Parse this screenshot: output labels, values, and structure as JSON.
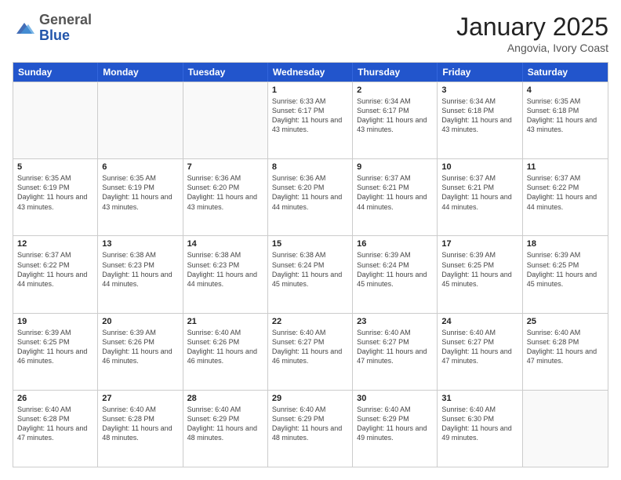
{
  "header": {
    "logo": {
      "general": "General",
      "blue": "Blue"
    },
    "title": "January 2025",
    "subtitle": "Angovia, Ivory Coast"
  },
  "days_of_week": [
    "Sunday",
    "Monday",
    "Tuesday",
    "Wednesday",
    "Thursday",
    "Friday",
    "Saturday"
  ],
  "weeks": [
    [
      {
        "day": "",
        "info": ""
      },
      {
        "day": "",
        "info": ""
      },
      {
        "day": "",
        "info": ""
      },
      {
        "day": "1",
        "info": "Sunrise: 6:33 AM\nSunset: 6:17 PM\nDaylight: 11 hours and 43 minutes."
      },
      {
        "day": "2",
        "info": "Sunrise: 6:34 AM\nSunset: 6:17 PM\nDaylight: 11 hours and 43 minutes."
      },
      {
        "day": "3",
        "info": "Sunrise: 6:34 AM\nSunset: 6:18 PM\nDaylight: 11 hours and 43 minutes."
      },
      {
        "day": "4",
        "info": "Sunrise: 6:35 AM\nSunset: 6:18 PM\nDaylight: 11 hours and 43 minutes."
      }
    ],
    [
      {
        "day": "5",
        "info": "Sunrise: 6:35 AM\nSunset: 6:19 PM\nDaylight: 11 hours and 43 minutes."
      },
      {
        "day": "6",
        "info": "Sunrise: 6:35 AM\nSunset: 6:19 PM\nDaylight: 11 hours and 43 minutes."
      },
      {
        "day": "7",
        "info": "Sunrise: 6:36 AM\nSunset: 6:20 PM\nDaylight: 11 hours and 43 minutes."
      },
      {
        "day": "8",
        "info": "Sunrise: 6:36 AM\nSunset: 6:20 PM\nDaylight: 11 hours and 44 minutes."
      },
      {
        "day": "9",
        "info": "Sunrise: 6:37 AM\nSunset: 6:21 PM\nDaylight: 11 hours and 44 minutes."
      },
      {
        "day": "10",
        "info": "Sunrise: 6:37 AM\nSunset: 6:21 PM\nDaylight: 11 hours and 44 minutes."
      },
      {
        "day": "11",
        "info": "Sunrise: 6:37 AM\nSunset: 6:22 PM\nDaylight: 11 hours and 44 minutes."
      }
    ],
    [
      {
        "day": "12",
        "info": "Sunrise: 6:37 AM\nSunset: 6:22 PM\nDaylight: 11 hours and 44 minutes."
      },
      {
        "day": "13",
        "info": "Sunrise: 6:38 AM\nSunset: 6:23 PM\nDaylight: 11 hours and 44 minutes."
      },
      {
        "day": "14",
        "info": "Sunrise: 6:38 AM\nSunset: 6:23 PM\nDaylight: 11 hours and 44 minutes."
      },
      {
        "day": "15",
        "info": "Sunrise: 6:38 AM\nSunset: 6:24 PM\nDaylight: 11 hours and 45 minutes."
      },
      {
        "day": "16",
        "info": "Sunrise: 6:39 AM\nSunset: 6:24 PM\nDaylight: 11 hours and 45 minutes."
      },
      {
        "day": "17",
        "info": "Sunrise: 6:39 AM\nSunset: 6:25 PM\nDaylight: 11 hours and 45 minutes."
      },
      {
        "day": "18",
        "info": "Sunrise: 6:39 AM\nSunset: 6:25 PM\nDaylight: 11 hours and 45 minutes."
      }
    ],
    [
      {
        "day": "19",
        "info": "Sunrise: 6:39 AM\nSunset: 6:25 PM\nDaylight: 11 hours and 46 minutes."
      },
      {
        "day": "20",
        "info": "Sunrise: 6:39 AM\nSunset: 6:26 PM\nDaylight: 11 hours and 46 minutes."
      },
      {
        "day": "21",
        "info": "Sunrise: 6:40 AM\nSunset: 6:26 PM\nDaylight: 11 hours and 46 minutes."
      },
      {
        "day": "22",
        "info": "Sunrise: 6:40 AM\nSunset: 6:27 PM\nDaylight: 11 hours and 46 minutes."
      },
      {
        "day": "23",
        "info": "Sunrise: 6:40 AM\nSunset: 6:27 PM\nDaylight: 11 hours and 47 minutes."
      },
      {
        "day": "24",
        "info": "Sunrise: 6:40 AM\nSunset: 6:27 PM\nDaylight: 11 hours and 47 minutes."
      },
      {
        "day": "25",
        "info": "Sunrise: 6:40 AM\nSunset: 6:28 PM\nDaylight: 11 hours and 47 minutes."
      }
    ],
    [
      {
        "day": "26",
        "info": "Sunrise: 6:40 AM\nSunset: 6:28 PM\nDaylight: 11 hours and 47 minutes."
      },
      {
        "day": "27",
        "info": "Sunrise: 6:40 AM\nSunset: 6:28 PM\nDaylight: 11 hours and 48 minutes."
      },
      {
        "day": "28",
        "info": "Sunrise: 6:40 AM\nSunset: 6:29 PM\nDaylight: 11 hours and 48 minutes."
      },
      {
        "day": "29",
        "info": "Sunrise: 6:40 AM\nSunset: 6:29 PM\nDaylight: 11 hours and 48 minutes."
      },
      {
        "day": "30",
        "info": "Sunrise: 6:40 AM\nSunset: 6:29 PM\nDaylight: 11 hours and 49 minutes."
      },
      {
        "day": "31",
        "info": "Sunrise: 6:40 AM\nSunset: 6:30 PM\nDaylight: 11 hours and 49 minutes."
      },
      {
        "day": "",
        "info": ""
      }
    ]
  ]
}
